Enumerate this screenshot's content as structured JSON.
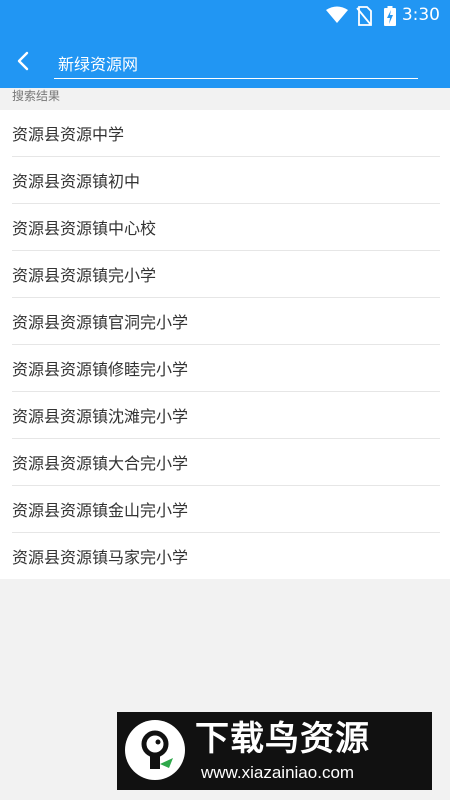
{
  "status_bar": {
    "time": "3:30",
    "icons": [
      "wifi-icon",
      "no-sim-icon",
      "battery-charging-icon"
    ]
  },
  "header": {
    "back_icon": "chevron-left-icon",
    "search_value": "新绿资源网"
  },
  "results": {
    "section_label": "搜索结果",
    "items": [
      {
        "label": "资源县资源中学"
      },
      {
        "label": "资源县资源镇初中"
      },
      {
        "label": "资源县资源镇中心校"
      },
      {
        "label": "资源县资源镇完小学"
      },
      {
        "label": "资源县资源镇官洞完小学"
      },
      {
        "label": "资源县资源镇修睦完小学"
      },
      {
        "label": "资源县资源镇沈滩完小学"
      },
      {
        "label": "资源县资源镇大合完小学"
      },
      {
        "label": "资源县资源镇金山完小学"
      },
      {
        "label": "资源县资源镇马家完小学"
      }
    ]
  },
  "watermark": {
    "title": "下载鸟资源",
    "url": "www.xiazainiao.com"
  },
  "colors": {
    "primary": "#2196f3",
    "background": "#f2f2f2",
    "text": "#333333"
  }
}
